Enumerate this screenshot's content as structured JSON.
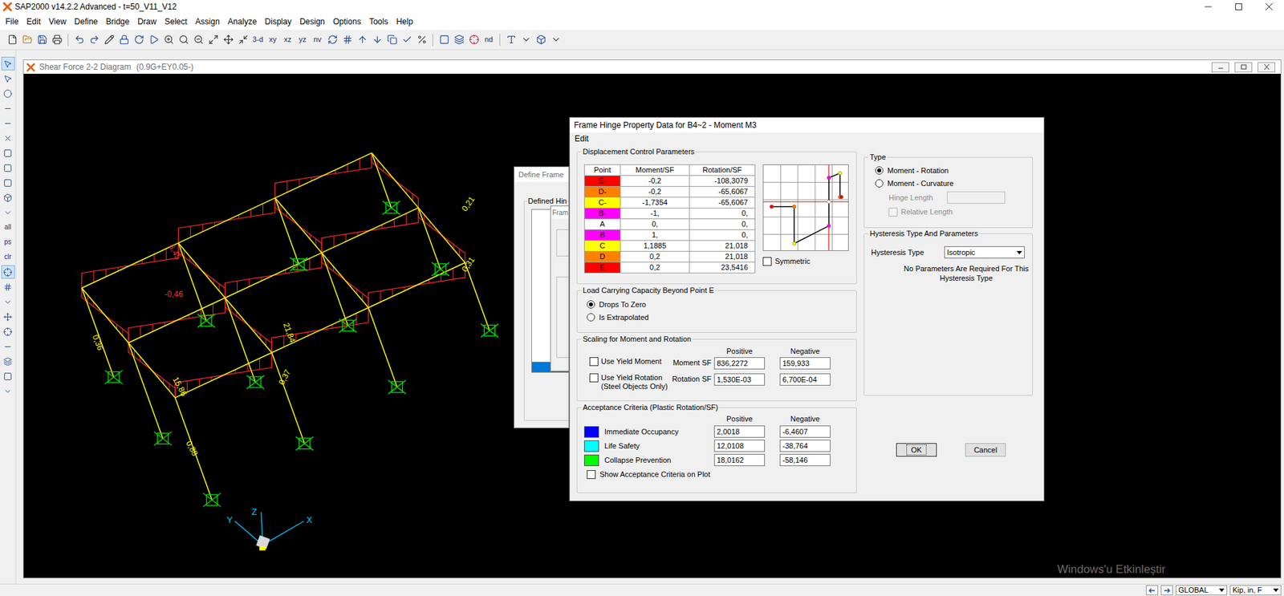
{
  "app_window": {
    "title": "SAP2000 v14.2.2 Advanced - t=50_V11_V12"
  },
  "menu_bar": [
    "File",
    "Edit",
    "View",
    "Define",
    "Bridge",
    "Draw",
    "Select",
    "Assign",
    "Analyze",
    "Display",
    "Design",
    "Options",
    "Tools",
    "Help"
  ],
  "toolbar": [
    "3-d",
    "xy",
    "xz",
    "yz",
    "nv",
    "nd"
  ],
  "side_toolbar": [
    "all",
    "ps",
    "clr"
  ],
  "view_window": {
    "title": "Shear Force 2-2 Diagram",
    "load_case": "(0.9G+EY0.05-)",
    "diagram": {
      "labels": [
        {
          "text": "0,36",
          "color": "#ffff00"
        },
        {
          "text": "15,86",
          "color": "#ffff00"
        },
        {
          "text": "0,88",
          "color": "#ffff00"
        },
        {
          "text": "0,37",
          "color": "#ffff00"
        },
        {
          "text": "21,84",
          "color": "#ffff00"
        },
        {
          "text": "0,31",
          "color": "#ffff00"
        },
        {
          "text": "0,21",
          "color": "#ffff00"
        },
        {
          "text": "-0,46",
          "color": "#ff3030"
        },
        {
          "text": "6,45",
          "color": "#ff3030"
        }
      ],
      "axes": [
        "X",
        "Y",
        "Z"
      ]
    },
    "watermark": "Windows'u Etkinleştir"
  },
  "back_dialog": {
    "title": "Define Frame",
    "group": "Defined Hin",
    "inner_title": "Fram",
    "list_rows": [
      {
        "selected": false
      },
      {
        "selected": false
      },
      {
        "selected": false
      },
      {
        "selected": false
      },
      {
        "selected": false
      },
      {
        "selected": false
      },
      {
        "selected": false
      },
      {
        "selected": false
      },
      {
        "selected": false
      },
      {
        "selected": false
      },
      {
        "selected": false
      },
      {
        "selected": false
      },
      {
        "selected": false
      },
      {
        "selected": false
      },
      {
        "selected": false
      },
      {
        "selected": true
      }
    ]
  },
  "hinge_dialog": {
    "title": "Frame Hinge Property Data for B4~2 - Moment M3",
    "menu": [
      "Edit"
    ],
    "displacement": {
      "title": "Displacement Control Parameters",
      "columns": [
        "Point",
        "Moment/SF",
        "Rotation/SF"
      ],
      "rows": [
        {
          "point": "E-",
          "moment": "-0,2",
          "rotation": "-108,3079",
          "color": "#ff0000"
        },
        {
          "point": "D-",
          "moment": "-0,2",
          "rotation": "-65,6067",
          "color": "#ff8000"
        },
        {
          "point": "C-",
          "moment": "-1,7354",
          "rotation": "-65,6067",
          "color": "#ffff00"
        },
        {
          "point": "B-",
          "moment": "-1,",
          "rotation": "0,",
          "color": "#ff00ff"
        },
        {
          "point": "A",
          "moment": "0,",
          "rotation": "0,",
          "color": "#ffffff"
        },
        {
          "point": "B",
          "moment": "1,",
          "rotation": "0,",
          "color": "#ff00ff"
        },
        {
          "point": "C",
          "moment": "1,1885",
          "rotation": "21,018",
          "color": "#ffff00"
        },
        {
          "point": "D",
          "moment": "0,2",
          "rotation": "21,018",
          "color": "#ff8000"
        },
        {
          "point": "E",
          "moment": "0,2",
          "rotation": "23,5416",
          "color": "#ff0000"
        }
      ],
      "plot": {
        "rotation": [
          -108.3079,
          -65.6067,
          -65.6067,
          0,
          0,
          0,
          21.018,
          21.018,
          23.5416
        ],
        "moment": [
          -0.2,
          -0.2,
          -1.7354,
          -1,
          0,
          1,
          1.1885,
          0.2,
          0.2
        ]
      },
      "symmetric": {
        "label": "Symmetric",
        "checked": false
      }
    },
    "beyond_e": {
      "title": "Load Carrying Capacity Beyond Point E",
      "options": [
        {
          "label": "Drops To Zero",
          "selected": true
        },
        {
          "label": "Is Extrapolated",
          "selected": false
        }
      ]
    },
    "scaling": {
      "title": "Scaling for Moment and Rotation",
      "headers": [
        "Positive",
        "Negative"
      ],
      "rows": [
        {
          "check": "Use Yield Moment",
          "note": "",
          "checked": false,
          "label": "Moment SF",
          "positive": "836,2272",
          "negative": "159,933"
        },
        {
          "check": "Use Yield Rotation",
          "note": "(Steel Objects Only)",
          "checked": false,
          "label": "Rotation SF",
          "positive": "1,530E-03",
          "negative": "6,700E-04"
        }
      ]
    },
    "acceptance": {
      "title": "Acceptance Criteria (Plastic Rotation/SF)",
      "headers": [
        "Positive",
        "Negative"
      ],
      "rows": [
        {
          "label": "Immediate Occupancy",
          "color": "#0000ff",
          "positive": "2,0018",
          "negative": "-6,4607"
        },
        {
          "label": "Life Safety",
          "color": "#00ffff",
          "positive": "12,0108",
          "negative": "-38,764"
        },
        {
          "label": "Collapse Prevention",
          "color": "#00ff00",
          "positive": "18,0162",
          "negative": "-58,146"
        }
      ],
      "show": {
        "label": "Show Acceptance Criteria on Plot",
        "checked": false
      }
    },
    "type": {
      "title": "Type",
      "options": [
        {
          "label": "Moment - Rotation",
          "selected": true
        },
        {
          "label": "Moment - Curvature",
          "selected": false
        }
      ],
      "hinge_length": {
        "label": "Hinge Length",
        "value": "",
        "disabled": true
      },
      "relative_length": {
        "label": "Relative Length",
        "checked": false,
        "disabled": true
      }
    },
    "hysteresis": {
      "title": "Hysteresis Type And Parameters",
      "label": "Hysteresis Type",
      "value": "Isotropic",
      "note": "No Parameters Are Required For This Hysteresis Type"
    },
    "buttons": [
      {
        "label": "OK",
        "focused": true
      },
      {
        "label": "Cancel",
        "focused": false
      }
    ]
  },
  "status_bar": {
    "coord_system": "GLOBAL",
    "units": "Kip, in, F"
  }
}
